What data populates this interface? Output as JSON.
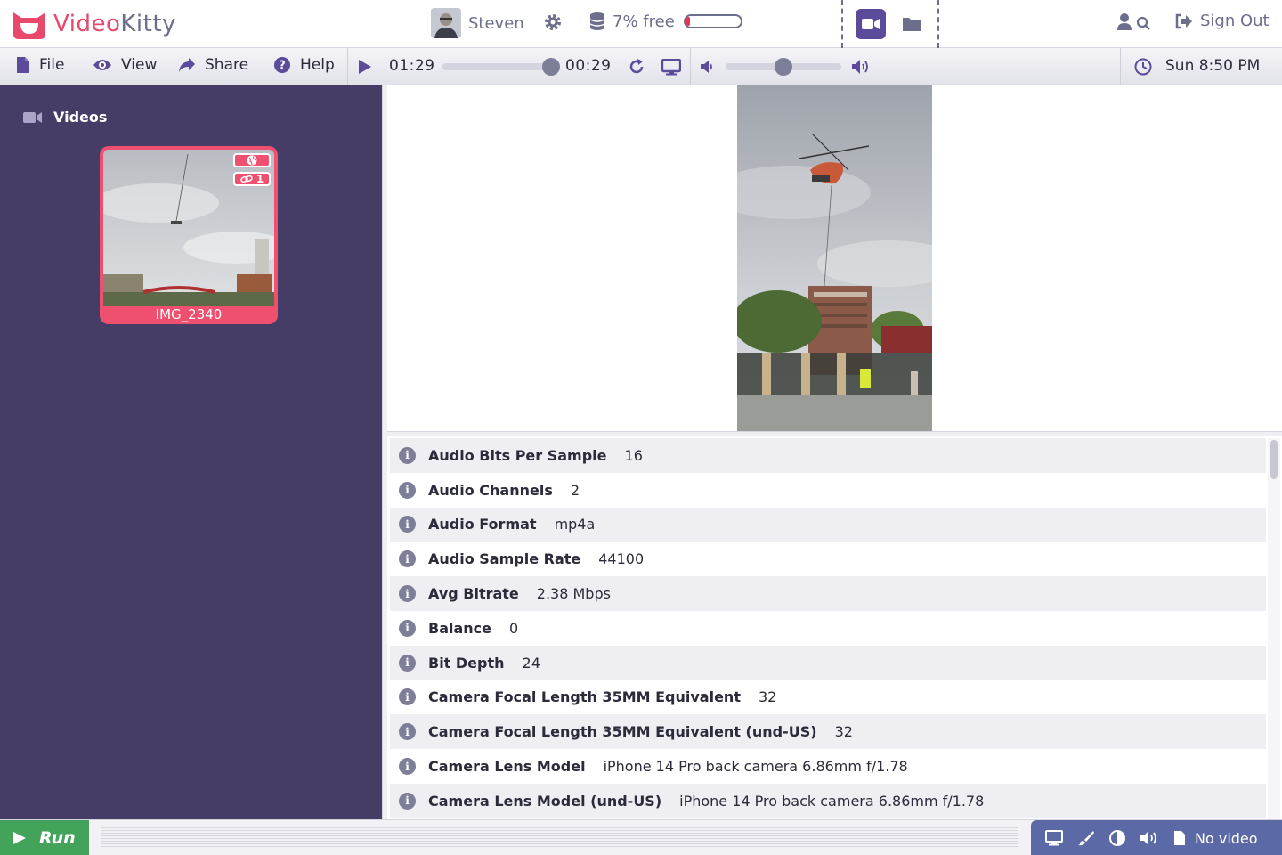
{
  "app": {
    "name_part1": "Video",
    "name_part2": "Kitty"
  },
  "user": {
    "name": "Steven"
  },
  "storage": {
    "label": "7% free",
    "used_fraction": 0.07
  },
  "signout": {
    "label": "Sign Out"
  },
  "menu": {
    "file": "File",
    "view": "View",
    "share": "Share",
    "help": "Help"
  },
  "player": {
    "position": "01:29",
    "duration": "00:29",
    "volume_fraction": 0.5
  },
  "clock": {
    "label": "Sun 8:50 PM"
  },
  "sidebar": {
    "title": "Videos",
    "items": [
      {
        "label": "IMG_2340",
        "badge_count": "1"
      }
    ]
  },
  "metadata": [
    {
      "key": "Audio Bits Per Sample",
      "value": "16"
    },
    {
      "key": "Audio Channels",
      "value": "2"
    },
    {
      "key": "Audio Format",
      "value": "mp4a"
    },
    {
      "key": "Audio Sample Rate",
      "value": "44100"
    },
    {
      "key": "Avg Bitrate",
      "value": "2.38 Mbps"
    },
    {
      "key": "Balance",
      "value": "0"
    },
    {
      "key": "Bit Depth",
      "value": "24"
    },
    {
      "key": "Camera Focal Length 35MM Equivalent",
      "value": "32"
    },
    {
      "key": "Camera Focal Length 35MM Equivalent (und-US)",
      "value": "32"
    },
    {
      "key": "Camera Lens Model",
      "value": "iPhone 14 Pro back camera 6.86mm f/1.78"
    },
    {
      "key": "Camera Lens Model (und-US)",
      "value": "iPhone 14 Pro back camera 6.86mm f/1.78"
    }
  ],
  "footer": {
    "run_label": "Run",
    "status_label": "No video"
  },
  "colors": {
    "brand": "#e8496b",
    "sidebar": "#453d66",
    "accent": "#5b4b9a",
    "run": "#43a35a",
    "status": "#5b6aa6"
  }
}
